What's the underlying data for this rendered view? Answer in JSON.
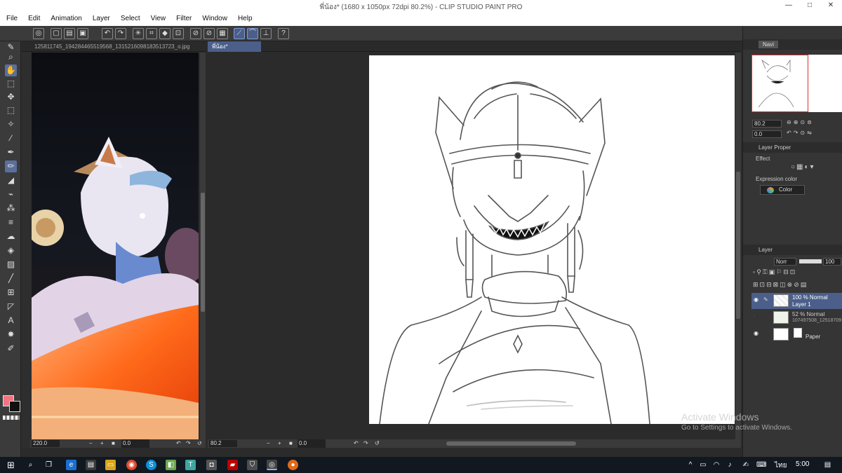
{
  "window": {
    "title": "พี่น้อง* (1680 x 1050px 72dpi 80.2%) - CLIP STUDIO PAINT PRO",
    "minimize": "—",
    "maximize": "□",
    "close": "✕"
  },
  "menu": [
    "File",
    "Edit",
    "Animation",
    "Layer",
    "Select",
    "View",
    "Filter",
    "Window",
    "Help"
  ],
  "left_panel": {
    "tab_label": "125811745_194284465519568_1315216098183513723_o.jpg",
    "zoom": "220.0",
    "angle": "0.0"
  },
  "canvas": {
    "tab_label": "พี่น้อง*",
    "zoom": "80.2",
    "angle": "0.0"
  },
  "navigator": {
    "tab_label": "Navi",
    "zoom": "80.2",
    "angle": "0.0"
  },
  "layer_property": {
    "header": "Layer Proper",
    "effect_label": "Effect",
    "expression_color_label": "Expression color",
    "expression_color_value": "Color"
  },
  "layers": {
    "header": "Layer",
    "blend_mode": "Norr",
    "opacity": "100",
    "items": [
      {
        "line1": "100 % Normal",
        "line2": "Layer 1",
        "visible": true,
        "selected": true
      },
      {
        "line1": "52 % Normal",
        "line2": "107497508_12518709",
        "visible": false,
        "selected": false
      },
      {
        "line1": "",
        "line2": "Paper",
        "visible": true,
        "selected": false
      }
    ]
  },
  "watermark": {
    "line1": "Activate Windows",
    "line2": "Go to Settings to activate Windows."
  },
  "taskbar": {
    "language": "ไทย",
    "time": "5:00"
  },
  "colors": {
    "main_color": "#f07482",
    "sub_color": "#111111",
    "accent": "#4b5f8a"
  }
}
